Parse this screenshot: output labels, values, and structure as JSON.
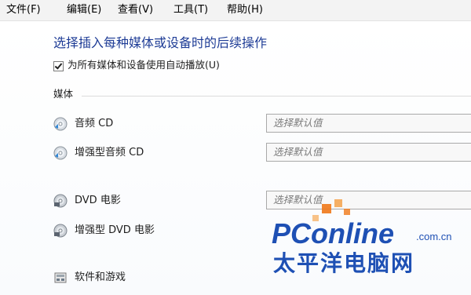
{
  "menu": [
    {
      "label": "文件(F)"
    },
    {
      "label": "编辑(E)"
    },
    {
      "label": "查看(V)"
    },
    {
      "label": "工具(T)"
    },
    {
      "label": "帮助(H)"
    }
  ],
  "page": {
    "heading": "选择插入每种媒体或设备时的后续操作",
    "autoplay_checkbox": {
      "label": "为所有媒体和设备使用自动播放(U)",
      "checked": true
    },
    "media_section_title": "媒体"
  },
  "media_items": [
    {
      "label": "音频 CD",
      "icon": "audio-cd-icon",
      "action": "选择默认值"
    },
    {
      "label": "增强型音频 CD",
      "icon": "enhanced-audio-cd-icon",
      "action": "选择默认值"
    },
    {
      "label": "DVD 电影",
      "icon": "dvd-movie-icon",
      "action": "选择默认值"
    },
    {
      "label": "增强型 DVD 电影",
      "icon": "enhanced-dvd-movie-icon",
      "action": ""
    },
    {
      "label": "软件和游戏",
      "icon": "software-games-icon",
      "action": ""
    }
  ],
  "watermark": {
    "brand": "PConline",
    "domain": ".com.cn",
    "tagline": "太平洋电脑网",
    "colors": {
      "brand": "#1e50b4",
      "accent": "#f07818"
    }
  },
  "colors": {
    "heading": "#1e3c96",
    "menubar": "#f3f3f3"
  }
}
